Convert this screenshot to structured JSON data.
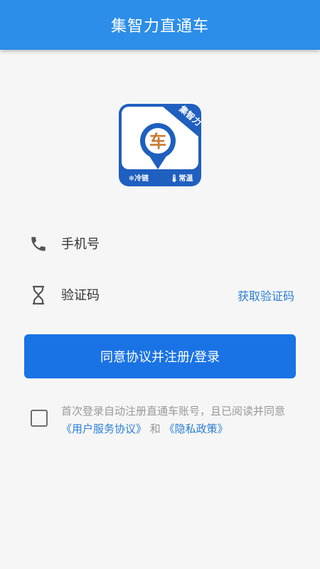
{
  "header": {
    "title": "集智力直通车"
  },
  "logo": {
    "main_char": "车",
    "banner_text": "集智力",
    "badge_left": "❄冷链",
    "badge_right": "🌡常温",
    "colors": {
      "blue": "#1f5fbf",
      "orange": "#c77a2f"
    }
  },
  "form": {
    "phone_placeholder": "手机号",
    "code_placeholder": "验证码",
    "get_code_label": "获取验证码",
    "submit_label": "同意协议并注册/登录"
  },
  "agreement": {
    "text_prefix": "首次登录自动注册直通车账号，且已阅读并同意",
    "user_agreement_link": "《用户服务协议》",
    "and_text": " 和 ",
    "privacy_policy_link": "《隐私政策》",
    "checked": false
  },
  "colors": {
    "header_bg": "#2c8ee8",
    "primary_button": "#1a73e4",
    "link": "#2a7fd4",
    "muted_text": "#999999"
  },
  "icons": [
    "phone-icon",
    "hourglass-icon",
    "app-logo"
  ]
}
